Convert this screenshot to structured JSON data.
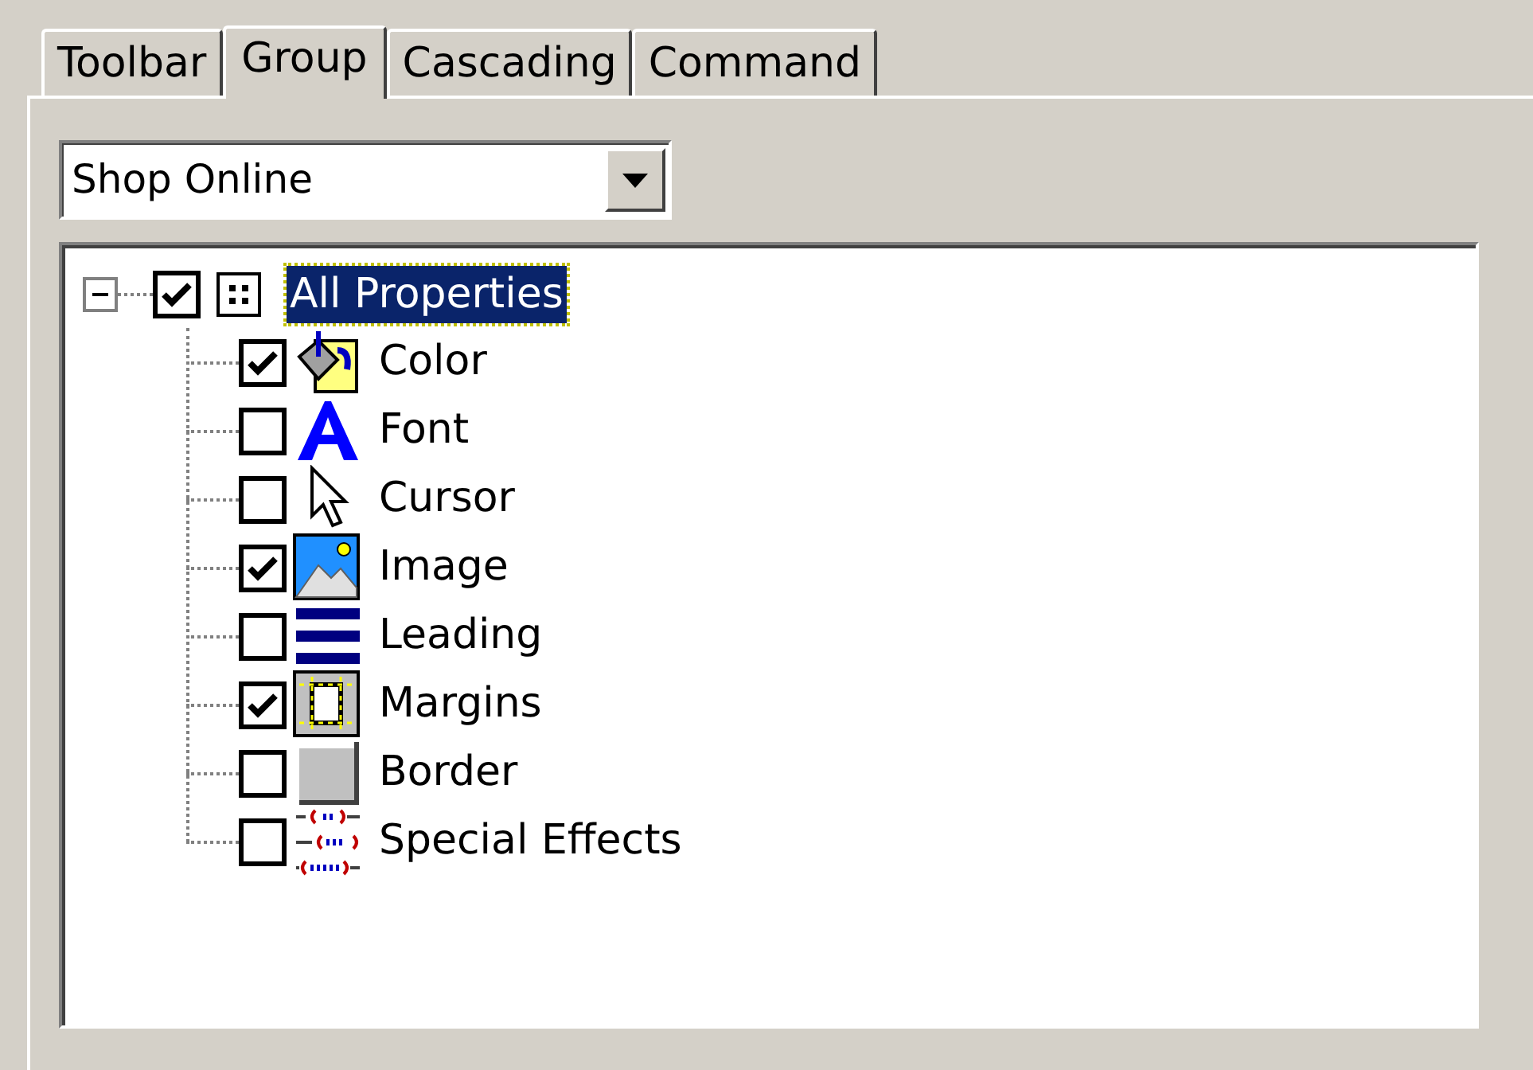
{
  "tabs": [
    {
      "label": "Toolbar",
      "selected": false
    },
    {
      "label": "Group",
      "selected": true
    },
    {
      "label": "Cascading",
      "selected": false
    },
    {
      "label": "Command",
      "selected": false
    }
  ],
  "group_dropdown": {
    "value": "Shop Online"
  },
  "tree": {
    "label": "All Properties",
    "checked": true,
    "expanded": true,
    "selected": true,
    "children": [
      {
        "label": "Color",
        "checked": true,
        "kind": "color"
      },
      {
        "label": "Font",
        "checked": false,
        "kind": "font"
      },
      {
        "label": "Cursor",
        "checked": false,
        "kind": "cursor"
      },
      {
        "label": "Image",
        "checked": true,
        "kind": "image"
      },
      {
        "label": "Leading",
        "checked": false,
        "kind": "leading"
      },
      {
        "label": "Margins",
        "checked": true,
        "kind": "margins"
      },
      {
        "label": "Border",
        "checked": false,
        "kind": "border"
      },
      {
        "label": "Special Effects",
        "checked": false,
        "kind": "effects"
      }
    ]
  }
}
